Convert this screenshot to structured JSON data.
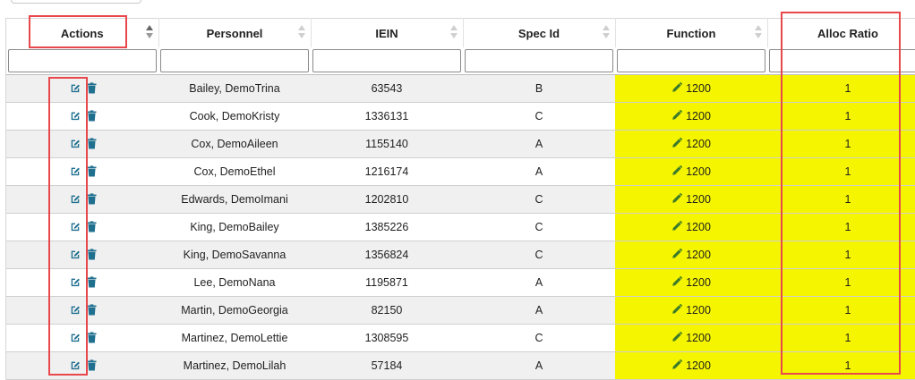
{
  "columns": [
    {
      "label": "Actions"
    },
    {
      "label": "Personnel"
    },
    {
      "label": "IEIN"
    },
    {
      "label": "Spec Id"
    },
    {
      "label": "Function"
    },
    {
      "label": "Alloc Ratio"
    }
  ],
  "rows": [
    {
      "personnel": "Bailey, DemoTrina",
      "iein": "63543",
      "spec_id": "B",
      "function": "1200",
      "alloc_ratio": "1"
    },
    {
      "personnel": "Cook, DemoKristy",
      "iein": "1336131",
      "spec_id": "C",
      "function": "1200",
      "alloc_ratio": "1"
    },
    {
      "personnel": "Cox, DemoAileen",
      "iein": "1155140",
      "spec_id": "A",
      "function": "1200",
      "alloc_ratio": "1"
    },
    {
      "personnel": "Cox, DemoEthel",
      "iein": "1216174",
      "spec_id": "A",
      "function": "1200",
      "alloc_ratio": "1"
    },
    {
      "personnel": "Edwards, DemoImani",
      "iein": "1202810",
      "spec_id": "C",
      "function": "1200",
      "alloc_ratio": "1"
    },
    {
      "personnel": "King, DemoBailey",
      "iein": "1385226",
      "spec_id": "C",
      "function": "1200",
      "alloc_ratio": "1"
    },
    {
      "personnel": "King, DemoSavanna",
      "iein": "1356824",
      "spec_id": "C",
      "function": "1200",
      "alloc_ratio": "1"
    },
    {
      "personnel": "Lee, DemoNana",
      "iein": "1195871",
      "spec_id": "A",
      "function": "1200",
      "alloc_ratio": "1"
    },
    {
      "personnel": "Martin, DemoGeorgia",
      "iein": "82150",
      "spec_id": "A",
      "function": "1200",
      "alloc_ratio": "1"
    },
    {
      "personnel": "Martinez, DemoLettie",
      "iein": "1308595",
      "spec_id": "C",
      "function": "1200",
      "alloc_ratio": "1"
    },
    {
      "personnel": "Martinez, DemoLilah",
      "iein": "57184",
      "spec_id": "A",
      "function": "1200",
      "alloc_ratio": "1"
    }
  ],
  "colors": {
    "highlight": "#f5f500",
    "icon": "#1f6f8f",
    "callout": "#e8484b"
  },
  "icons": {
    "edit": "edit-icon",
    "delete": "trash-icon",
    "function_edit": "pencil-icon"
  }
}
